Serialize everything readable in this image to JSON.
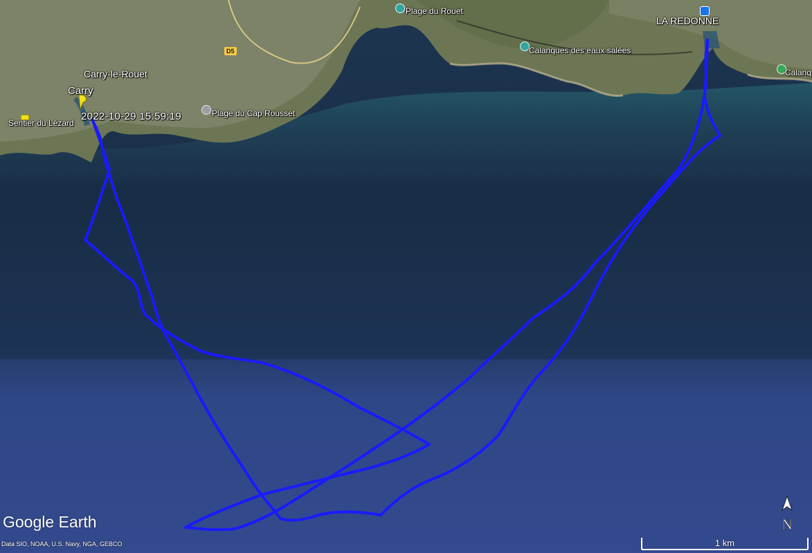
{
  "map": {
    "labels": {
      "carry_le_rouet": "Carry-le-Rouet",
      "carry": "Carry",
      "sentier_lezard": "Sentier du Lézard",
      "plage_rouet": "Plage du Rouet",
      "plage_cap_rousset": "Plage du Cap Rousset",
      "calanques_eaux_salees": "Calanques des eaux salées",
      "la_redonne": "LA REDONNE",
      "calanq": "Calanq",
      "road_d5": "D5"
    },
    "track": {
      "timestamp": "2022-10-29 15:59:19",
      "color": "#1a1aff"
    },
    "colors": {
      "deep_sea": "#1b2f4a",
      "open_sea": "#30488a",
      "shallow": "#1f5f6a",
      "land": "#6f7a55"
    },
    "overlay": {
      "logo": "Google Earth",
      "credit": "Data SIO, NOAA, U.S. Navy, NGA, GEBCO",
      "compass_letter": "N",
      "scale": "1 km"
    }
  }
}
